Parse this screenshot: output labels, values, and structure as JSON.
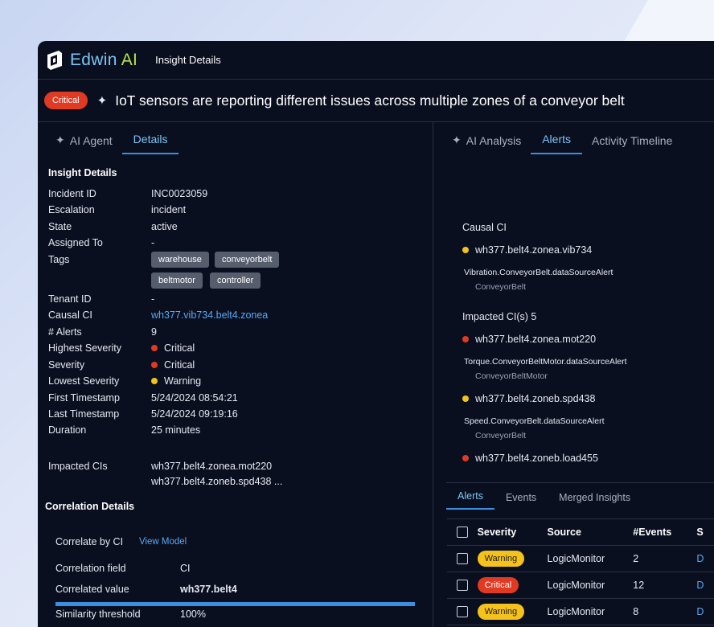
{
  "app": {
    "brand_main": "Edwin ",
    "brand_accent": "AI",
    "page_title": "Insight Details"
  },
  "headline": {
    "severity_badge": "Critical",
    "title": "IoT sensors are reporting different issues across multiple zones of a conveyor belt"
  },
  "left_tabs": [
    {
      "label": "AI Agent"
    },
    {
      "label": "Details"
    }
  ],
  "insight_details": {
    "section_title": "Insight Details",
    "labels": {
      "incident_id": "Incident ID",
      "escalation": "Escalation",
      "state": "State",
      "assigned_to": "Assigned To",
      "tags": "Tags",
      "tenant_id": "Tenant ID",
      "causal_ci": "Causal CI",
      "alerts": "# Alerts",
      "highest_severity": "Highest Severity",
      "severity": "Severity",
      "lowest_severity": "Lowest Severity",
      "first_timestamp": "First Timestamp",
      "last_timestamp": "Last Timestamp",
      "duration": "Duration",
      "impacted_cis": "Impacted CIs"
    },
    "values": {
      "incident_id": "INC0023059",
      "escalation": "incident",
      "state": "active",
      "assigned_to": "-",
      "tags": [
        "warehouse",
        "conveyorbelt",
        "beltmotor",
        "controller"
      ],
      "tenant_id": "-",
      "causal_ci": "wh377.vib734.belt4.zonea",
      "alerts": "9",
      "highest_severity": "Critical",
      "severity": "Critical",
      "lowest_severity": "Warning",
      "first_timestamp": "5/24/2024 08:54:21",
      "last_timestamp": "5/24/2024 09:19:16",
      "duration": "25 minutes",
      "impacted_cis": [
        "wh377.belt4.zonea.mot220",
        "wh377.belt4.zoneb.spd438 ..."
      ]
    }
  },
  "correlation": {
    "section_title": "Correlation Details",
    "correlate_by": "Correlate by CI",
    "view_model": "View Model",
    "field_label": "Correlation field",
    "field_value": "CI",
    "value_label": "Correlated value",
    "value_value": "wh377.belt4",
    "threshold_label": "Similarity threshold",
    "threshold_value": "100%"
  },
  "right_tabs": [
    {
      "label": "AI Analysis"
    },
    {
      "label": "Alerts"
    },
    {
      "label": "Activity Timeline"
    }
  ],
  "causal_ci": {
    "title": "Causal CI",
    "name": "wh377.belt4.zonea.vib734",
    "alert": "Vibration.ConveyorBelt.dataSourceAlert",
    "type": "ConveyorBelt"
  },
  "impacted": {
    "title": "Impacted CI(s) 5",
    "items": [
      {
        "name": "wh377.belt4.zonea.mot220",
        "alert": "Torque.ConveyorBeltMotor.dataSourceAlert",
        "type": "ConveyorBeltMotor"
      },
      {
        "name": "wh377.belt4.zoneb.spd438",
        "alert": "Speed.ConveyorBelt.dataSourceAlert",
        "type": "ConveyorBelt"
      },
      {
        "name": "wh377.belt4.zoneb.load455"
      }
    ]
  },
  "sub_tabs": [
    {
      "label": "Alerts"
    },
    {
      "label": "Events"
    },
    {
      "label": "Merged Insights"
    }
  ],
  "alerts_table": {
    "headers": [
      "Severity",
      "Source",
      "#Events",
      "S"
    ],
    "rows": [
      {
        "severity": "Warning",
        "source": "LogicMonitor",
        "events": "2",
        "extra": "D"
      },
      {
        "severity": "Critical",
        "source": "LogicMonitor",
        "events": "12",
        "extra": "D"
      },
      {
        "severity": "Warning",
        "source": "LogicMonitor",
        "events": "8",
        "extra": "D"
      }
    ]
  },
  "colors": {
    "background": "#0a0f1f",
    "accent": "#3b8fe0",
    "critical": "#e03a22",
    "warning": "#f4c21a",
    "brand_accent": "#b1e34a"
  }
}
